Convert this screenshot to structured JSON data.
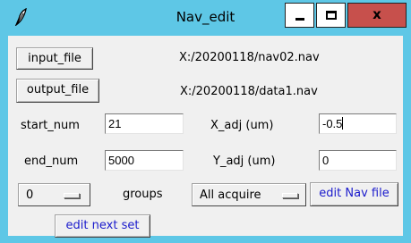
{
  "window": {
    "title": "Nav_edit",
    "titlebar_color": "#5ec7e6",
    "close_color": "#c7504c",
    "close_label": "x"
  },
  "io": {
    "input_button": "input_file",
    "input_path": "X:/20200118/nav02.nav",
    "output_button": "output_file",
    "output_path": "X:/20200118/data1.nav"
  },
  "fields": {
    "start_num_label": "start_num",
    "start_num_value": "21",
    "end_num_label": "end_num",
    "end_num_value": "5000",
    "x_adj_label": "X_adj (um)",
    "x_adj_value": "-0.5",
    "y_adj_label": "Y_adj (um)",
    "y_adj_value": "0"
  },
  "controls": {
    "groups_value": "0",
    "groups_label": "groups",
    "acquire_value": "All acquire",
    "edit_nav_button": "edit Nav file",
    "edit_next_button": "edit next set",
    "link_color": "#1a1acc"
  },
  "icons": {
    "app": "feather-icon",
    "minimize": "minimize-icon",
    "maximize": "maximize-icon",
    "close": "close-icon"
  }
}
